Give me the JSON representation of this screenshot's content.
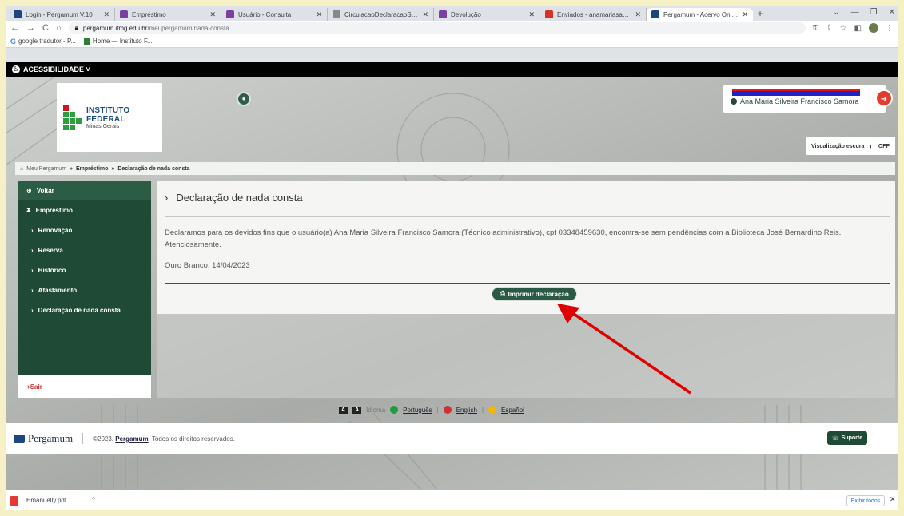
{
  "browser": {
    "tabs": [
      {
        "title": "Login - Pergamum V.10",
        "color": "#1c4680",
        "active": false
      },
      {
        "title": "Empréstimo",
        "color": "#7b3fa0",
        "active": false
      },
      {
        "title": "Usuário - Consulta",
        "color": "#7b3fa0",
        "active": false
      },
      {
        "title": "CirculacaoDeclaracaoServlet",
        "color": "#888888",
        "active": false
      },
      {
        "title": "Devolução",
        "color": "#7b3fa0",
        "active": false
      },
      {
        "title": "Enviados - anamariasamora@i",
        "color": "#d93025",
        "active": false
      },
      {
        "title": "Pergamum - Acervo Online",
        "color": "#1c4680",
        "active": true
      }
    ],
    "new_tab": "+",
    "window_controls": [
      "⌄",
      "—",
      "❐",
      "✕"
    ],
    "url_host": "pergamum.ifmg.edu.br",
    "url_path": "/meupergamum/nada-consta",
    "bookmarks": [
      {
        "label": "google tradutor - P..."
      },
      {
        "label": "Home — Instituto F..."
      }
    ]
  },
  "accessibility": {
    "label": "ACESSIBILIDADE ˅"
  },
  "logo": {
    "line1": "INSTITUTO FEDERAL",
    "line2": "Minas Gerais"
  },
  "user": {
    "name": "Ana Maria Silveira Francisco Samora"
  },
  "dark_mode": {
    "label": "Visualização escura",
    "state": "OFF"
  },
  "breadcrumb": {
    "home": "Meu Pergamum",
    "sep": "»",
    "section": "Empréstimo",
    "page": "Declaração de nada consta"
  },
  "sidebar": {
    "back": "Voltar",
    "group": "Empréstimo",
    "items": [
      "Renovação",
      "Reserva",
      "Histórico",
      "Afastamento",
      "Declaração de nada consta"
    ],
    "logout": "Sair"
  },
  "main": {
    "title": "Declaração de nada consta",
    "text": "Declaramos para os devidos fins que o usuário(a) Ana Maria Silveira Francisco Samora (Técnico administrativo), cpf 03348459630, encontra-se sem pendências com a Biblioteca José Bernardino Reis. Atenciosamente.",
    "date": "Ouro Branco, 14/04/2023",
    "print_label": "Imprimir declaração"
  },
  "languages": {
    "acc_a": "A",
    "acc_b": "A",
    "acc_text": "Idioma",
    "items": [
      "Português",
      "English",
      "Español"
    ]
  },
  "footer": {
    "brand": "Pergamum",
    "copyright_prefix": "©2023.",
    "copyright_link": "Pergamum",
    "copyright_suffix": ". Todos os direitos reservados.",
    "support": "Suporte"
  },
  "downloads": {
    "file": "Emanuelly.pdf",
    "show_all": "Exibir todos"
  },
  "colors": {
    "accent": "#1f4a35",
    "annotation": "#e00000"
  }
}
